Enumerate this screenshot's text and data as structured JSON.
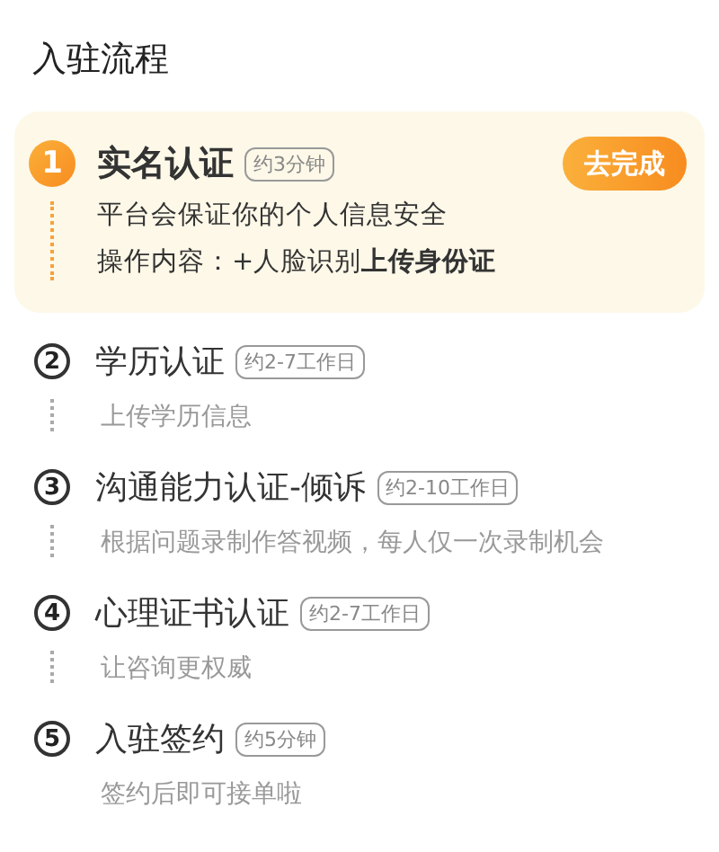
{
  "title": "入驻流程",
  "steps": [
    {
      "number": "1",
      "name": "实名认证",
      "duration": "约3分钟",
      "active": true,
      "action": "去完成",
      "lines": [
        "平台会保证你的个人信息安全",
        "操作内容：+人脸识别**上传身份证**"
      ]
    },
    {
      "number": "2",
      "name": "学历认证",
      "duration": "约2-7工作日",
      "active": false,
      "lines": [
        "上传学历信息"
      ]
    },
    {
      "number": "3",
      "name": "沟通能力认证-倾诉",
      "duration": "约2-10工作日",
      "active": false,
      "lines": [
        "根据问题录制作答视频，每人仅一次录制机会"
      ]
    },
    {
      "number": "4",
      "name": "心理证书认证",
      "duration": "约2-7工作日",
      "active": false,
      "lines": [
        "让咨询更权威"
      ]
    },
    {
      "number": "5",
      "name": "入驻签约",
      "duration": "约5分钟",
      "active": false,
      "lines": [
        "签约后即可接单啦"
      ]
    }
  ]
}
